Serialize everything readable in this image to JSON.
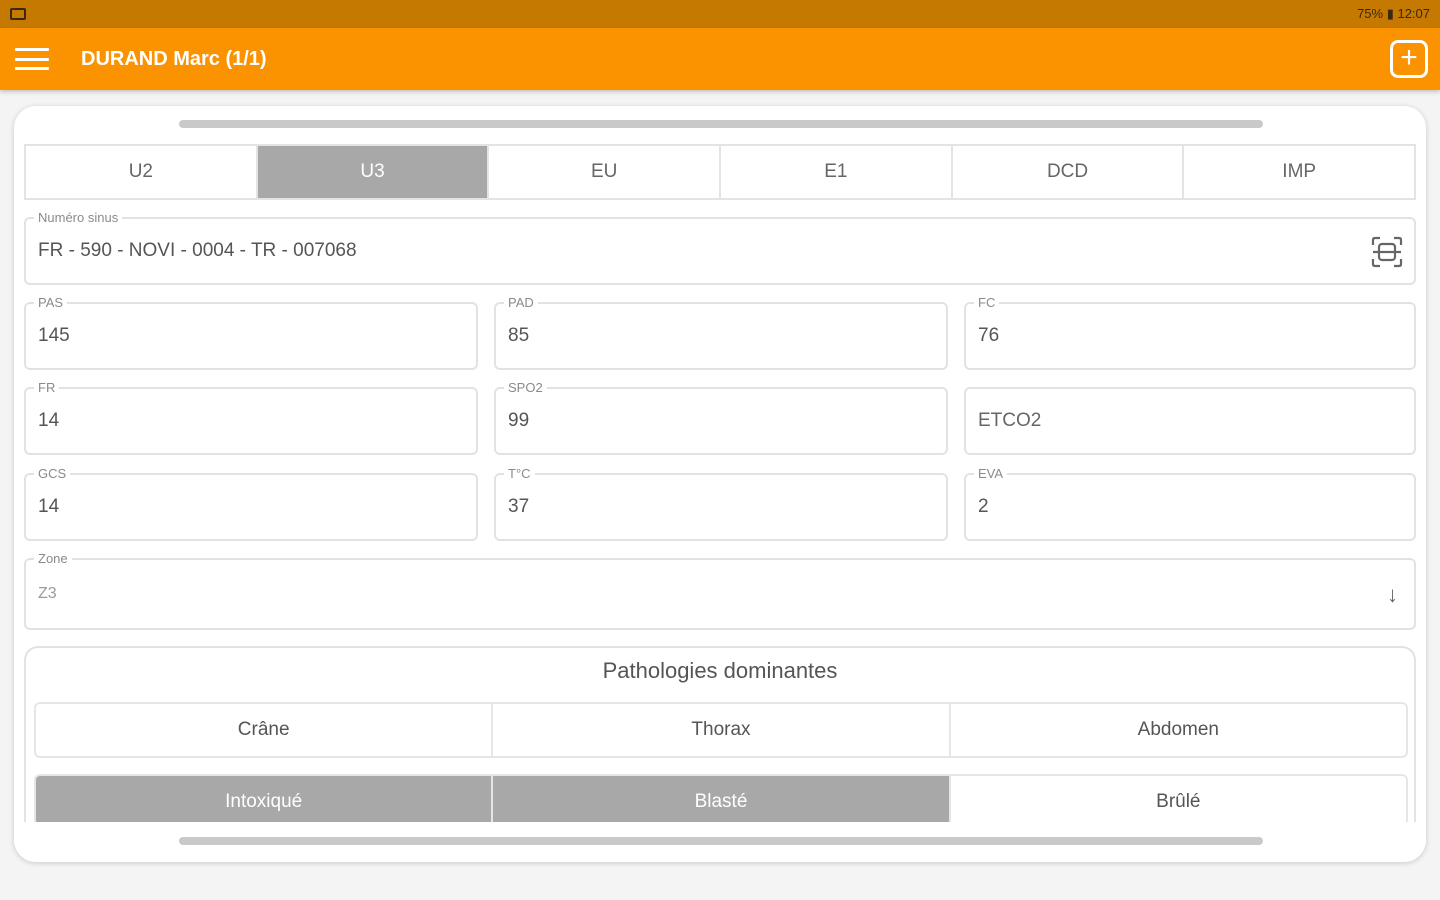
{
  "status_bar": {
    "right_text": "75% ▮ 12:07"
  },
  "app_bar": {
    "title": "DURAND Marc  (1/1)",
    "add_label": "+"
  },
  "tabs": [
    {
      "label": "U2",
      "active": false
    },
    {
      "label": "U3",
      "active": true
    },
    {
      "label": "EU",
      "active": false
    },
    {
      "label": "E1",
      "active": false
    },
    {
      "label": "DCD",
      "active": false
    },
    {
      "label": "IMP",
      "active": false
    }
  ],
  "sinus": {
    "label": "Numéro sinus",
    "value": "FR - 590 - NOVI - 0004 - TR - 007068"
  },
  "vitals": {
    "pas": {
      "label": "PAS",
      "value": "145"
    },
    "pad": {
      "label": "PAD",
      "value": "85"
    },
    "fc": {
      "label": "FC",
      "value": "76"
    },
    "fr": {
      "label": "FR",
      "value": "14"
    },
    "spo2": {
      "label": "SPO2",
      "value": "99"
    },
    "etco2": {
      "placeholder": "ETCO2"
    },
    "gcs": {
      "label": "GCS",
      "value": "14"
    },
    "temp": {
      "label": "T°C",
      "value": "37"
    },
    "eva": {
      "label": "EVA",
      "value": "2"
    }
  },
  "zone": {
    "label": "Zone",
    "value": "Z3"
  },
  "pathologies": {
    "title": "Pathologies dominantes",
    "row1": [
      {
        "label": "Crâne",
        "active": false
      },
      {
        "label": "Thorax",
        "active": false
      },
      {
        "label": "Abdomen",
        "active": false
      }
    ],
    "row2": [
      {
        "label": "Intoxiqué",
        "active": true
      },
      {
        "label": "Blasté",
        "active": true
      },
      {
        "label": "Brûlé",
        "active": false
      }
    ]
  },
  "colors": {
    "accent": "#fb9200",
    "status_bar": "#c57900",
    "active_tab": "#a8a8a8"
  }
}
